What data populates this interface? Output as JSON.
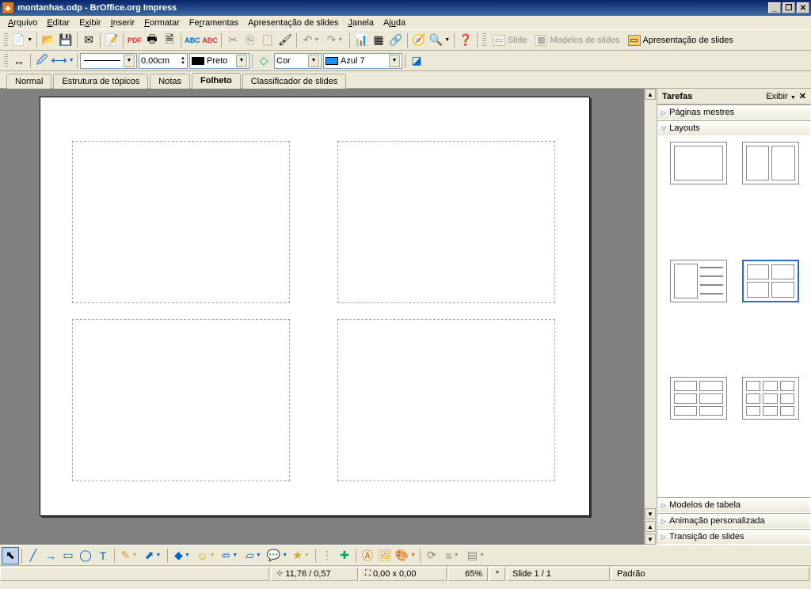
{
  "title": "montanhas.odp - BrOffice.org Impress",
  "menu": [
    "Arquivo",
    "Editar",
    "Exibir",
    "Inserir",
    "Formatar",
    "Ferramentas",
    "Apresentação de slides",
    "Janela",
    "Ajuda"
  ],
  "stdToolbar": {
    "slide_btn": "Slide",
    "models_btn": "Modelos de slides",
    "presentation_btn": "Apresentação de slides"
  },
  "lineToolbar": {
    "width": "0,00cm",
    "line_color_label": "Preto",
    "fill_label": "Cor",
    "fill_color_label": "Azul 7"
  },
  "viewTabs": [
    "Normal",
    "Estrutura de tópicos",
    "Notas",
    "Folheto",
    "Classificador de slides"
  ],
  "activeTab": "Folheto",
  "taskpane": {
    "title": "Tarefas",
    "view_link": "Exibir",
    "sections": {
      "master": "Páginas mestres",
      "layouts": "Layouts",
      "table": "Modelos de tabela",
      "anim": "Animação personalizada",
      "trans": "Transição de slides"
    }
  },
  "status": {
    "pos": "11,76 / 0,57",
    "size": "0,00 x 0,00",
    "zoom": "65%",
    "modified": "*",
    "slide": "Slide 1 / 1",
    "layout": "Padrão"
  }
}
